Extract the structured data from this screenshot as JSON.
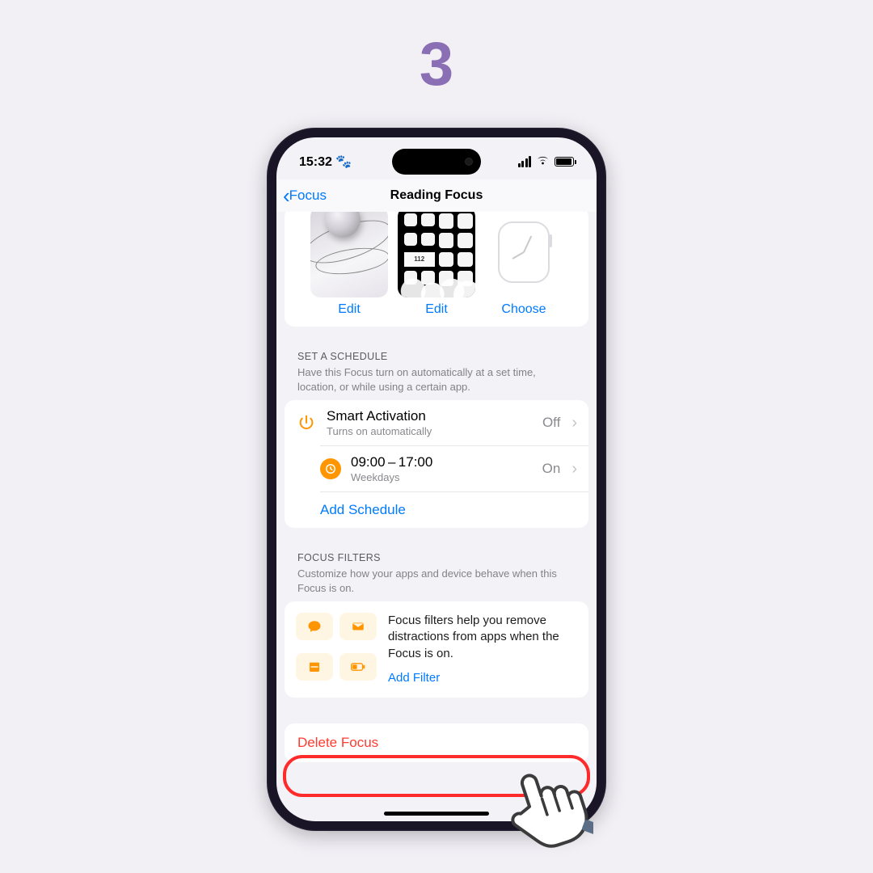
{
  "step_number": "3",
  "status_bar": {
    "time": "15:32 🐾"
  },
  "nav": {
    "back_label": "Focus",
    "title": "Reading Focus"
  },
  "screens": {
    "lock_action": "Edit",
    "home_action": "Edit",
    "watch_action": "Choose"
  },
  "schedule": {
    "header": "SET A SCHEDULE",
    "sub": "Have this Focus turn on automatically at a set time, location, or while using a certain app.",
    "rows": [
      {
        "title": "Smart Activation",
        "sub": "Turns on automatically",
        "value": "Off"
      },
      {
        "title": "09:00 – 17:00",
        "sub": "Weekdays",
        "value": "On"
      }
    ],
    "add_label": "Add Schedule"
  },
  "filters": {
    "header": "FOCUS FILTERS",
    "sub": "Customize how your apps and device behave when this Focus is on.",
    "desc": "Focus filters help you remove distractions from apps when the Focus is on.",
    "add_label": "Add Filter"
  },
  "delete_label": "Delete Focus"
}
